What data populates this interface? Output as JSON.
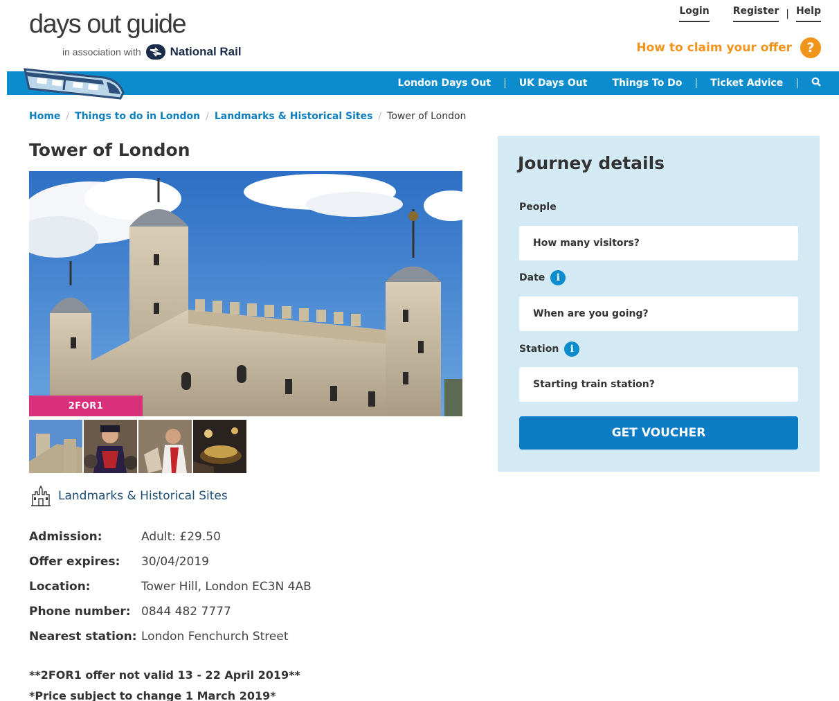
{
  "header": {
    "logo_title": "days out guide",
    "logo_assoc": "in association with",
    "logo_partner": "National Rail",
    "login": "Login",
    "register": "Register",
    "help": "Help",
    "claim_text": "How to claim your offer",
    "claim_icon": "?"
  },
  "nav": {
    "items": [
      "London Days Out",
      "UK Days Out",
      "Things To Do",
      "Ticket Advice"
    ],
    "search_icon": "search-icon"
  },
  "breadcrumb": {
    "items": [
      "Home",
      "Things to do in London",
      "Landmarks & Historical Sites"
    ],
    "current": "Tower of London"
  },
  "page": {
    "title": "Tower of London",
    "badge": "2FOR1",
    "category": "Landmarks & Historical Sites"
  },
  "details": [
    {
      "label": "Admission:",
      "value": "Adult: £29.50"
    },
    {
      "label": "Offer expires:",
      "value": "30/04/2019"
    },
    {
      "label": "Location:",
      "value": "Tower Hill, London EC3N 4AB"
    },
    {
      "label": "Phone number:",
      "value": "0844 482 7777"
    },
    {
      "label": "Nearest station:",
      "value": "London Fenchurch Street"
    }
  ],
  "notes": [
    "**2FOR1 offer not valid 13 - 22 April 2019**",
    "*Price subject to change 1 March 2019*"
  ],
  "journey": {
    "title": "Journey details",
    "people_label": "People",
    "people_placeholder": "How many visitors?",
    "date_label": "Date",
    "date_placeholder": "When are you going?",
    "station_label": "Station",
    "station_placeholder": "Starting train station?",
    "info_icon": "i",
    "button": "GET VOUCHER"
  },
  "colors": {
    "nav_blue": "#0d8ccd",
    "accent_orange": "#f0941b",
    "badge_pink": "#d8307a",
    "panel_bg": "#d3eaf5",
    "button_blue": "#0d7cc5"
  }
}
